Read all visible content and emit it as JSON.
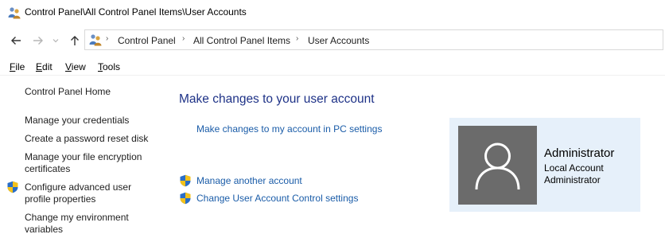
{
  "window": {
    "title": "Control Panel\\All Control Panel Items\\User Accounts"
  },
  "navigation": {
    "breadcrumbs": [
      "Control Panel",
      "All Control Panel Items",
      "User Accounts"
    ]
  },
  "menu": {
    "items": [
      {
        "underline": "F",
        "rest": "ile"
      },
      {
        "underline": "E",
        "rest": "dit"
      },
      {
        "underline": "V",
        "rest": "iew"
      },
      {
        "underline": "T",
        "rest": "ools"
      }
    ]
  },
  "sidebar": {
    "home": "Control Panel Home",
    "items": [
      {
        "line1": "Manage your credentials",
        "line2": ""
      },
      {
        "line1": "Create a password reset disk",
        "line2": ""
      },
      {
        "line1": "Manage your file encryption",
        "line2": "certificates"
      },
      {
        "line1": "Configure advanced user",
        "line2": "profile properties"
      },
      {
        "line1": "Change my environment",
        "line2": "variables"
      }
    ]
  },
  "main": {
    "heading": "Make changes to your user account",
    "pc_settings_link": "Make changes to my account in PC settings",
    "manage_another": "Manage another account",
    "uac_settings": "Change User Account Control settings"
  },
  "account": {
    "name": "Administrator",
    "type": "Local Account",
    "role": "Administrator"
  },
  "colors": {
    "link": "#1a5ca8",
    "heading": "#1e3287",
    "card_bg": "#e6f0fa",
    "avatar_bg": "#6b6b6b"
  }
}
